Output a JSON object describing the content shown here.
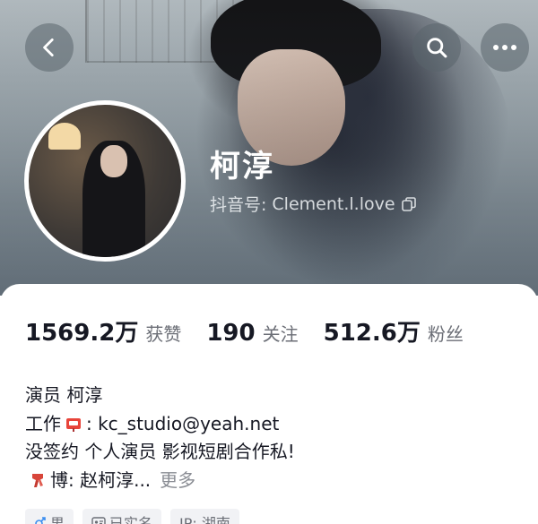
{
  "profile": {
    "name": "柯淳",
    "id_label": "抖音号:",
    "id_value": "Clement.l.love"
  },
  "icons": {
    "back": "chevron-left-icon",
    "search": "search-icon",
    "more": "more-horizontal-icon",
    "copy": "copy-icon",
    "mail": "mailbox-icon",
    "scarf": "scarf-icon",
    "gender_male": "male-icon",
    "verified": "id-card-icon"
  },
  "stats": [
    {
      "value": "1569.2万",
      "label": "获赞"
    },
    {
      "value": "190",
      "label": "关注"
    },
    {
      "value": "512.6万",
      "label": "粉丝"
    }
  ],
  "bio": {
    "line1": "演员 柯淳",
    "line2_prefix": "工作",
    "line2_suffix": ": kc_studio@yeah.net",
    "line3": "没签约 个人演员 影视短剧合作私!",
    "line4_text": "博: 赵柯淳...",
    "line4_more": "更多"
  },
  "tags": [
    {
      "label": "男"
    },
    {
      "label": "已实名"
    },
    {
      "label": "IP: 湖南"
    }
  ],
  "colors": {
    "primary_text": "#161823",
    "secondary_text": "#6b6e76",
    "more_link": "#8a8d94",
    "tag_bg": "#f1f2f5"
  }
}
